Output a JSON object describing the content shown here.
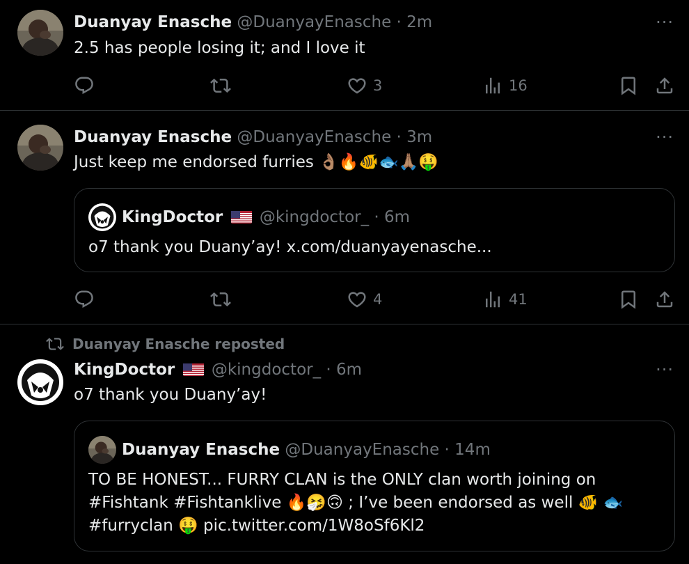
{
  "tweets": [
    {
      "name": "Duanyay Enasche",
      "handle": "@DuanyayEnasche",
      "dot": "·",
      "time": "2m",
      "text": "2.5 has people losing it; and I love it",
      "likes": "3",
      "views": "16"
    },
    {
      "name": "Duanyay Enasche",
      "handle": "@DuanyayEnasche",
      "dot": "·",
      "time": "3m",
      "text": "Just keep me endorsed furries 👌🏽🔥🐠🐟🙏🏽🤑",
      "quote": {
        "name": "KingDoctor",
        "flag": "🇺🇸",
        "handle": "@kingdoctor_",
        "dot": "·",
        "time": "6m",
        "text": "o7 thank you Duany’ay! x.com/duanyayenasche..."
      },
      "likes": "4",
      "views": "41"
    },
    {
      "repost_label": "Duanyay Enasche reposted",
      "name": "KingDoctor",
      "flag": "🇺🇸",
      "handle": "@kingdoctor_",
      "dot": "·",
      "time": "6m",
      "text": "o7 thank you Duany’ay!",
      "quote": {
        "name": "Duanyay Enasche",
        "handle": "@DuanyayEnasche",
        "dot": "·",
        "time": "14m",
        "line1": "TO BE HONEST... FURRY CLAN is the ONLY clan worth  joining on",
        "line2": "#Fishtank #Fishtanklive 🔥🤧🙃 ; I’ve been endorsed as well 🐠 🐟",
        "line3": "#furryclan 🤑 pic.twitter.com/1W8oSf6Kl2"
      }
    }
  ],
  "more_label": "···",
  "icons": {
    "reply": "reply-icon",
    "retweet": "retweet-icon",
    "like": "heart-icon",
    "views": "views-icon",
    "bookmark": "bookmark-icon",
    "share": "share-icon"
  },
  "colors": {
    "background": "#000000",
    "text": "#e7e9ea",
    "muted": "#71767b",
    "border": "#2f3336"
  }
}
